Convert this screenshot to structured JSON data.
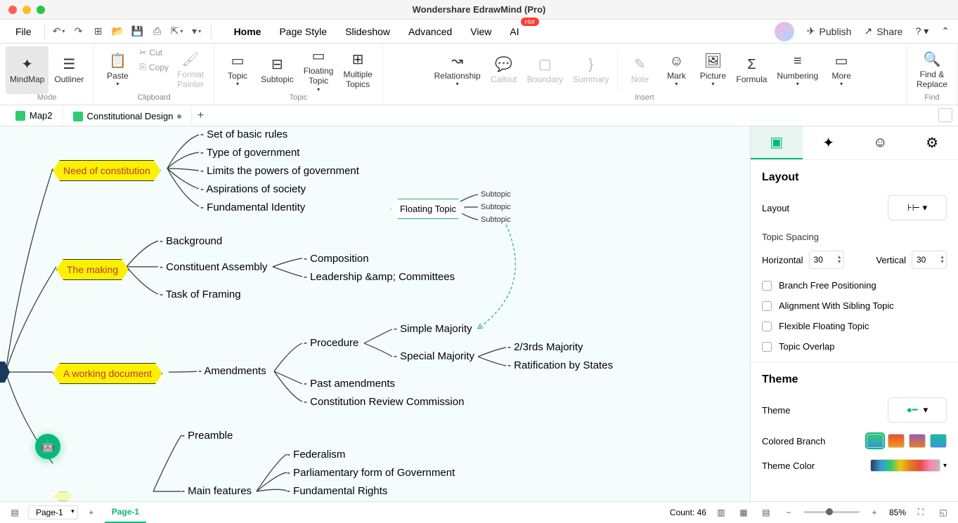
{
  "app_title": "Wondershare EdrawMind (Pro)",
  "menus": {
    "file": "File",
    "tabs": [
      "Home",
      "Page Style",
      "Slideshow",
      "Advanced",
      "View",
      "AI"
    ],
    "active_tab": "Home",
    "hot": "Hot",
    "publish": "Publish",
    "share": "Share"
  },
  "ribbon": {
    "mode": {
      "label": "Mode",
      "mindmap": "MindMap",
      "outliner": "Outliner"
    },
    "clipboard": {
      "label": "Clipboard",
      "paste": "Paste",
      "cut": "Cut",
      "copy": "Copy",
      "format_painter": "Format\nPainter"
    },
    "topic_group": {
      "label": "Topic",
      "topic": "Topic",
      "subtopic": "Subtopic",
      "floating": "Floating\nTopic",
      "multiple": "Multiple\nTopics"
    },
    "insert": {
      "label": "Insert",
      "relationship": "Relationship",
      "callout": "Callout",
      "boundary": "Boundary",
      "summary": "Summary",
      "note": "Note",
      "mark": "Mark",
      "picture": "Picture",
      "formula": "Formula",
      "numbering": "Numbering",
      "more": "More"
    },
    "find": {
      "label": "Find",
      "find_replace": "Find &\nReplace"
    }
  },
  "doc_tabs": {
    "map2": "Map2",
    "const": "Constitutional Design"
  },
  "mindmap": {
    "need": {
      "title": "Need of constitution",
      "items": [
        "- Set of basic rules",
        "- Type of government",
        "- Limits the powers of government",
        "- Aspirations of society",
        "- Fundamental Identity"
      ]
    },
    "making": {
      "title": "The making",
      "items": [
        "- Background",
        "- Constituent Assembly",
        "- Task of Framing"
      ],
      "sub": [
        "- Composition",
        "- Leadership &amp; Committees"
      ]
    },
    "working": {
      "title": "A working document",
      "amend": "- Amendments",
      "items": [
        "- Procedure",
        "- Past amendments",
        "- Constitution Review Commission"
      ],
      "proc": [
        "- Simple Majority",
        "- Special Majority"
      ],
      "special": [
        "- 2/3rds Majority",
        "- Ratification by States"
      ]
    },
    "features": {
      "pre": "- Preamble",
      "main": "- Main features",
      "items": [
        "- Federalism",
        "- Parliamentary form of Government",
        "- Fundamental Rights"
      ]
    },
    "floating": {
      "title": "Floating Topic",
      "sub": "Subtopic"
    }
  },
  "sidepanel": {
    "layout_h": "Layout",
    "layout": "Layout",
    "topic_spacing": "Topic Spacing",
    "horizontal": "Horizontal",
    "h_val": "30",
    "vertical": "Vertical",
    "v_val": "30",
    "branch_free": "Branch Free Positioning",
    "align_sibling": "Alignment With Sibling Topic",
    "flex_float": "Flexible Floating Topic",
    "overlap": "Topic Overlap",
    "theme_h": "Theme",
    "theme": "Theme",
    "colored_branch": "Colored Branch",
    "theme_color": "Theme Color"
  },
  "statusbar": {
    "page": "Page-1",
    "page_tab": "Page-1",
    "count": "Count: 46",
    "zoom": "85%"
  }
}
